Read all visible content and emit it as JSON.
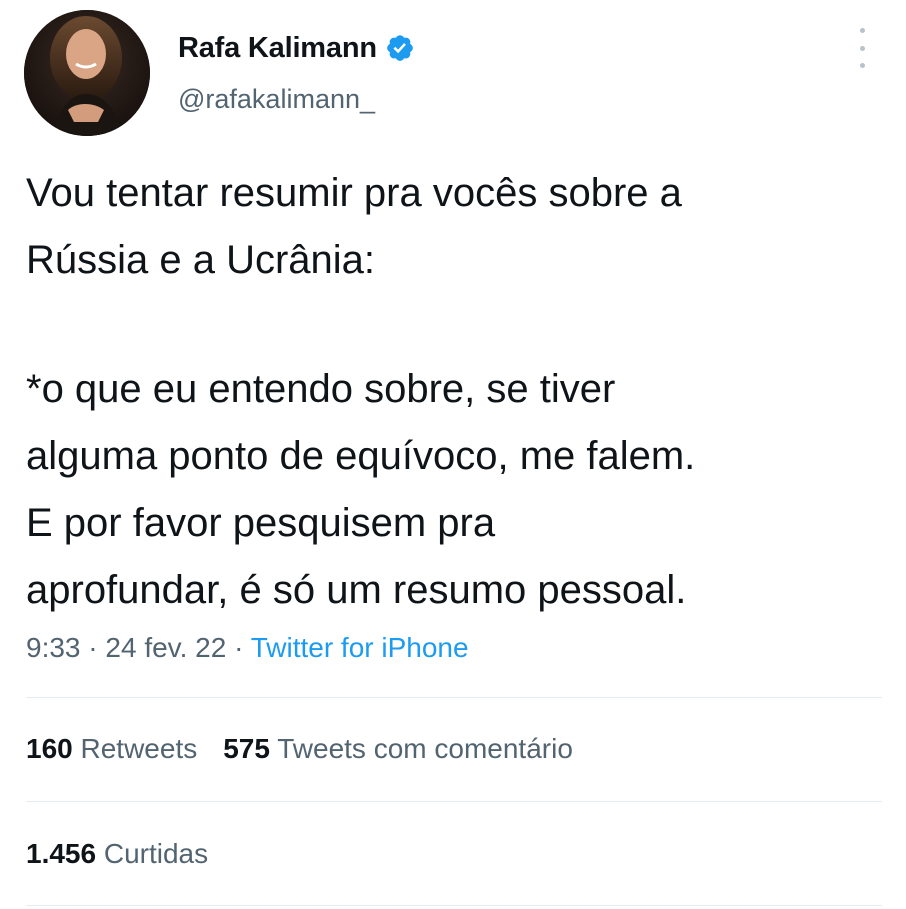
{
  "user": {
    "display_name": "Rafa Kalimann",
    "handle": "@rafakalimann_",
    "verified": true
  },
  "tweet": {
    "paragraph1": "Vou tentar resumir pra vocês sobre a\nRússia e a Ucrânia:",
    "paragraph2": "*o que eu entendo sobre, se tiver\nalguma ponto de equívoco, me falem.\nE por favor pesquisem pra\naprofundar, é só um resumo pessoal."
  },
  "meta": {
    "time": "9:33",
    "separator": " · ",
    "date": "24 fev. 22",
    "source": "Twitter for iPhone"
  },
  "stats": {
    "retweets_count": "160",
    "retweets_label": "Retweets",
    "quotes_count": "575",
    "quotes_label": "Tweets com comentário",
    "likes_count": "1.456",
    "likes_label": "Curtidas"
  },
  "colors": {
    "text": "#0f1419",
    "secondary": "#536471",
    "accent": "#1d9bf0",
    "divider": "#e6ecf0"
  },
  "icons": {
    "verified": "verified-badge-icon",
    "more": "more-options-icon"
  }
}
